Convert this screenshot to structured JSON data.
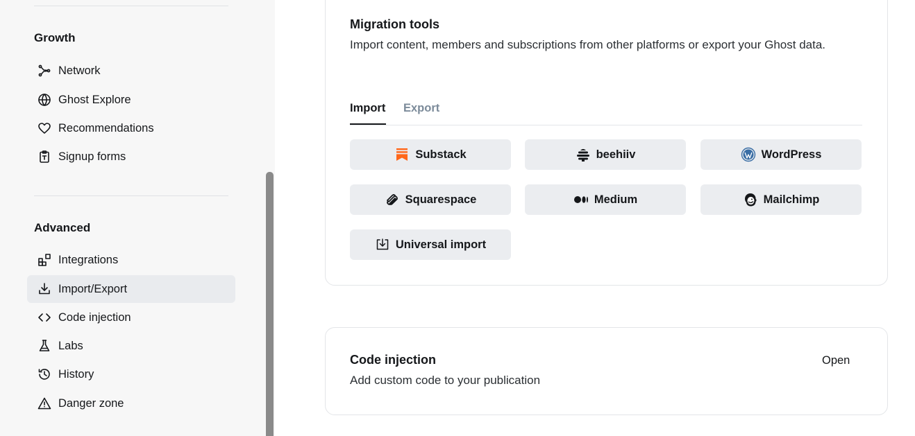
{
  "sidebar": {
    "growth": {
      "title": "Growth",
      "items": [
        {
          "label": "Network",
          "icon": "network-icon"
        },
        {
          "label": "Ghost Explore",
          "icon": "globe-icon"
        },
        {
          "label": "Recommendations",
          "icon": "heart-icon"
        },
        {
          "label": "Signup forms",
          "icon": "clipboard-icon"
        }
      ]
    },
    "advanced": {
      "title": "Advanced",
      "items": [
        {
          "label": "Integrations",
          "icon": "integrations-icon"
        },
        {
          "label": "Import/Export",
          "icon": "download-icon",
          "active": true
        },
        {
          "label": "Code injection",
          "icon": "code-icon"
        },
        {
          "label": "Labs",
          "icon": "flask-icon"
        },
        {
          "label": "History",
          "icon": "history-icon"
        },
        {
          "label": "Danger zone",
          "icon": "warning-icon"
        }
      ]
    }
  },
  "migration": {
    "title": "Migration tools",
    "description": "Import content, members and subscriptions from other platforms or export your Ghost data.",
    "tabs": [
      {
        "label": "Import",
        "active": true
      },
      {
        "label": "Export",
        "active": false
      }
    ],
    "buttons": [
      {
        "label": "Substack",
        "icon": "substack-icon"
      },
      {
        "label": "beehiiv",
        "icon": "beehiiv-icon"
      },
      {
        "label": "WordPress",
        "icon": "wordpress-icon"
      },
      {
        "label": "Squarespace",
        "icon": "squarespace-icon"
      },
      {
        "label": "Medium",
        "icon": "medium-icon"
      },
      {
        "label": "Mailchimp",
        "icon": "mailchimp-icon"
      },
      {
        "label": "Universal import",
        "icon": "import-icon"
      }
    ]
  },
  "code_injection": {
    "title": "Code injection",
    "description": "Add custom code to your publication",
    "action": "Open"
  },
  "colors": {
    "accent_substack": "#ff6719",
    "wordpress": "#3a6ea5",
    "active_bg": "#e9ebee",
    "button_bg": "#ebedf0"
  }
}
